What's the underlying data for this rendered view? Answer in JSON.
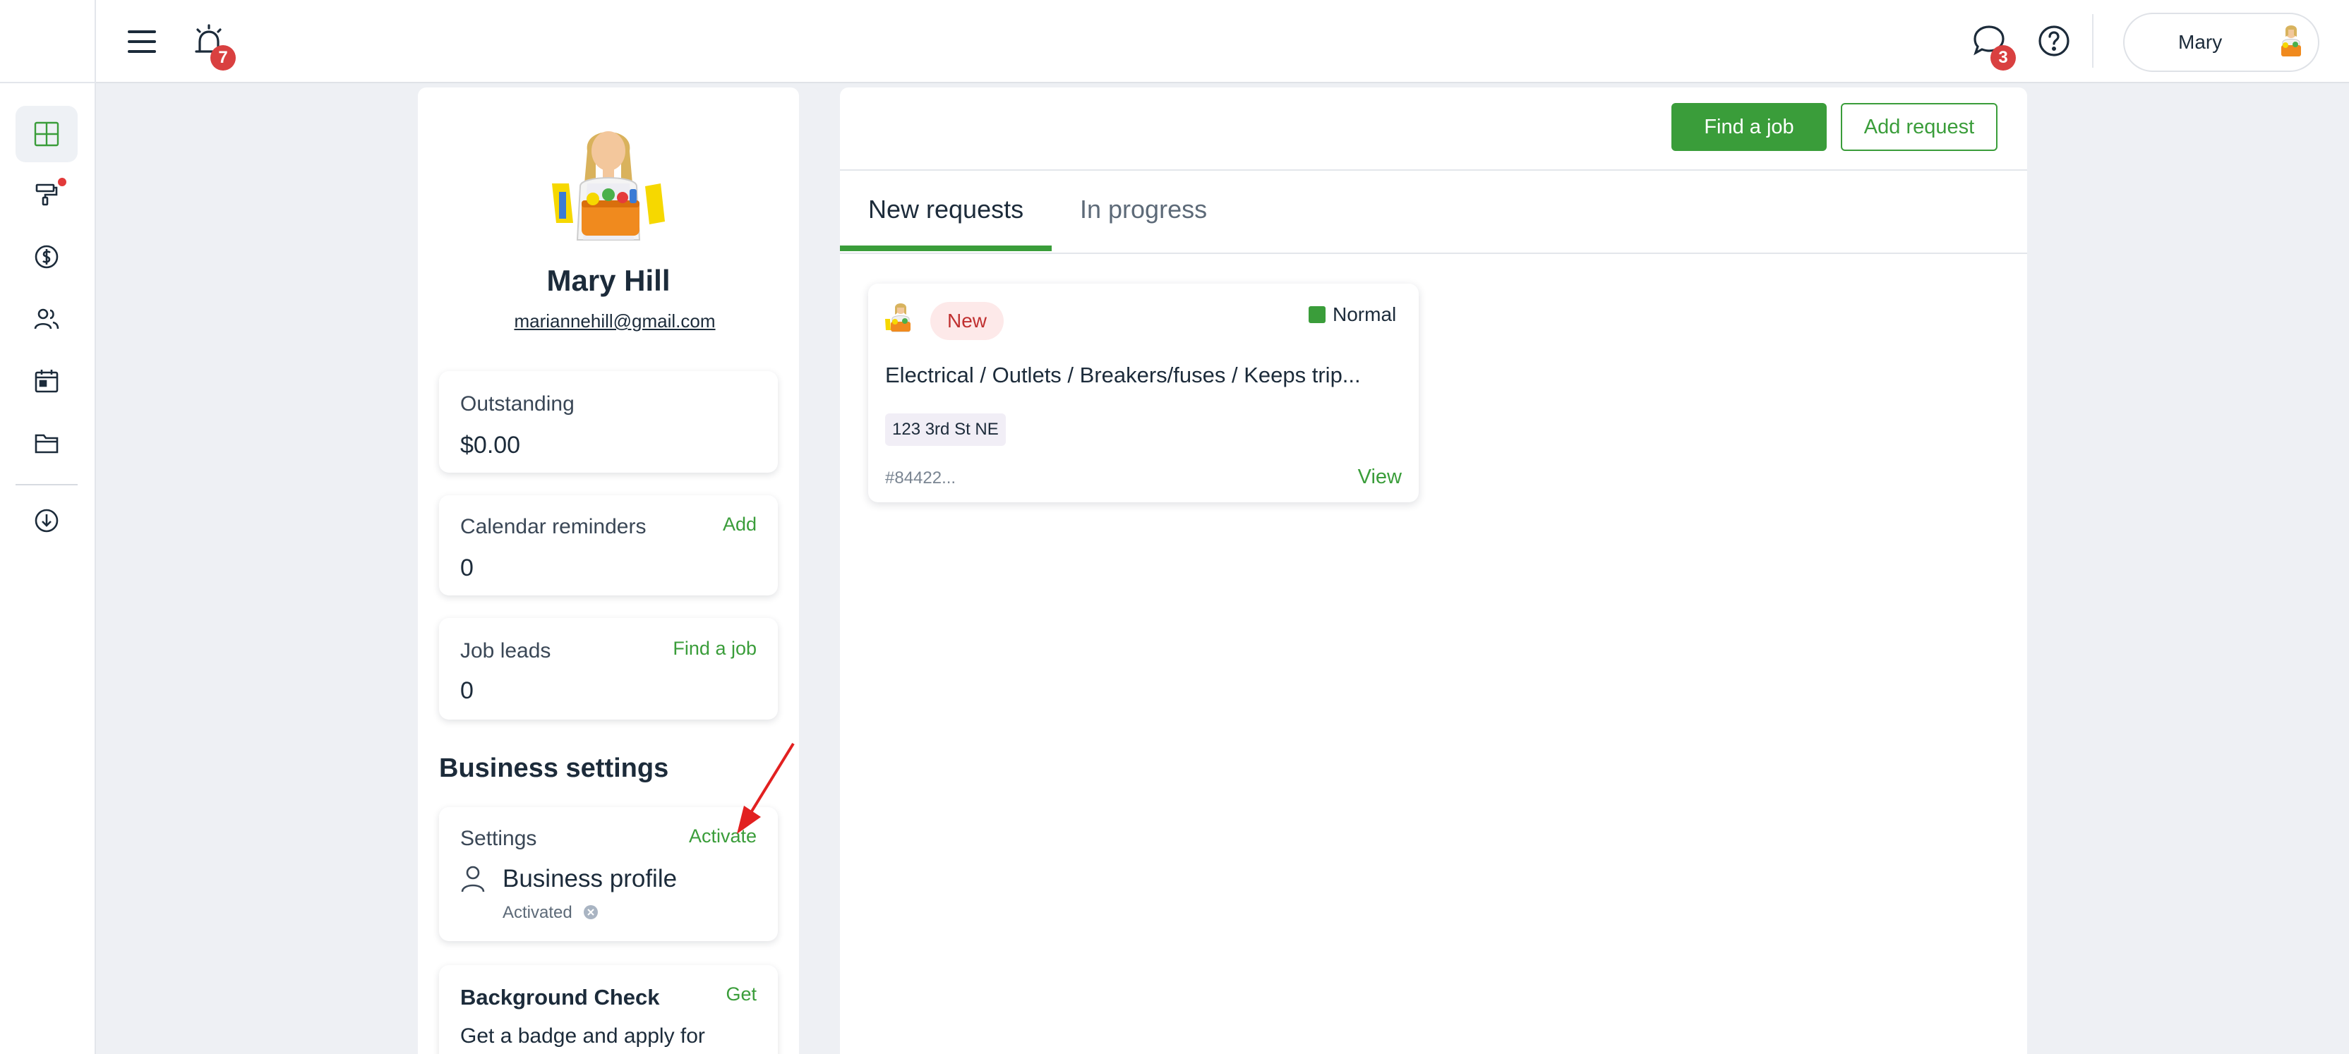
{
  "topbar": {
    "notifications_count": "7",
    "messages_count": "3",
    "user_name": "Mary"
  },
  "profile": {
    "name": "Mary Hill",
    "email": "mariannehill@gmail.com"
  },
  "cards": {
    "outstanding": {
      "label": "Outstanding",
      "value": "$0.00"
    },
    "calendar": {
      "label": "Calendar reminders",
      "value": "0",
      "link": "Add"
    },
    "job_leads": {
      "label": "Job leads",
      "value": "0",
      "link": "Find a job"
    }
  },
  "business_settings": {
    "title": "Business settings",
    "settings_label": "Settings",
    "settings_link": "Activate",
    "profile_title": "Business profile",
    "profile_status": "Activated"
  },
  "background_check": {
    "title": "Background Check",
    "link": "Get",
    "text": "Get a badge and apply for"
  },
  "main": {
    "find_job_button": "Find a job",
    "add_request_button": "Add request",
    "tabs": [
      {
        "label": "New requests"
      },
      {
        "label": "In progress"
      }
    ]
  },
  "request": {
    "badge": "New",
    "priority": "Normal",
    "title": "Electrical / Outlets / Breakers/fuses / Keeps trip...",
    "address": "123 3rd St NE",
    "id": "#84422...",
    "view_link": "View"
  },
  "colors": {
    "accent": "#3a9d3a",
    "badge_red": "#d94040",
    "new_badge_bg": "#fde9e9"
  }
}
